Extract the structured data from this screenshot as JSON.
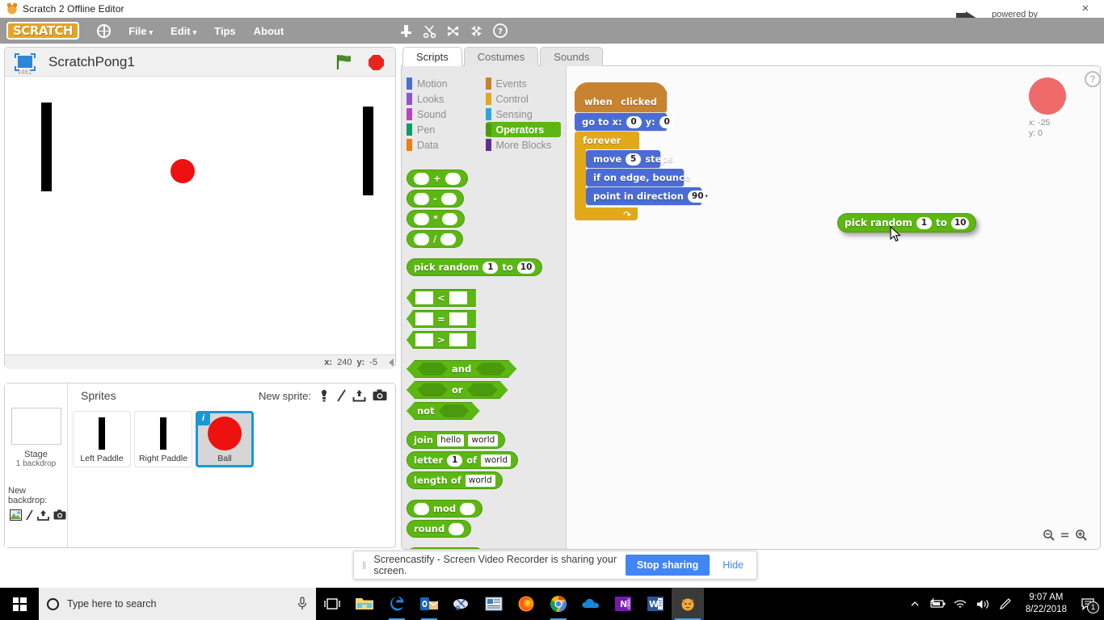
{
  "window": {
    "title": "Scratch 2 Offline Editor",
    "favicon": "scratch-cat-icon",
    "close_label": "×"
  },
  "branding": {
    "powered_by": "powered by",
    "name": "Screencastify"
  },
  "menubar": {
    "logo": "SCRATCH",
    "globe": "globe-icon",
    "items": [
      {
        "label": "File",
        "caret": "▾"
      },
      {
        "label": "Edit",
        "caret": "▾"
      },
      {
        "label": "Tips",
        "caret": ""
      },
      {
        "label": "About",
        "caret": ""
      }
    ],
    "tools": [
      "duplicate-icon",
      "cut-icon",
      "grow-icon",
      "shrink-icon",
      "block-help-icon"
    ]
  },
  "stage": {
    "version": "v461",
    "project_name": "ScratchPong1",
    "green_flag": "green-flag-icon",
    "stop": "stop-icon",
    "mouse_x_label": "x:",
    "mouse_x": "240",
    "mouse_y_label": "y:",
    "mouse_y": "-5",
    "sprites_on_stage": [
      {
        "name": "Left Paddle",
        "type": "paddle"
      },
      {
        "name": "Right Paddle",
        "type": "paddle"
      },
      {
        "name": "Ball",
        "type": "ball"
      }
    ]
  },
  "sprite_panel": {
    "stage_label": "Stage",
    "stage_sublabel": "1 backdrop",
    "new_backdrop_label": "New backdrop:",
    "backdrop_icons": [
      "library-icon",
      "paint-icon",
      "upload-icon",
      "camera-icon"
    ],
    "sprites_title": "Sprites",
    "new_sprite_label": "New sprite:",
    "new_sprite_icons": [
      "library-icon",
      "paint-icon",
      "upload-icon",
      "camera-icon"
    ],
    "sprites": [
      {
        "name": "Left Paddle",
        "selected": false,
        "type": "paddle"
      },
      {
        "name": "Right Paddle",
        "selected": false,
        "type": "paddle"
      },
      {
        "name": "Ball",
        "selected": true,
        "type": "ball",
        "badge": "i"
      }
    ]
  },
  "tabs": [
    {
      "label": "Scripts",
      "active": true
    },
    {
      "label": "Costumes",
      "active": false
    },
    {
      "label": "Sounds",
      "active": false
    }
  ],
  "palette": {
    "categories_left": [
      {
        "label": "Motion",
        "color": "#4a6cd4",
        "active": false
      },
      {
        "label": "Looks",
        "color": "#8a55d5",
        "active": false
      },
      {
        "label": "Sound",
        "color": "#bb42c3",
        "active": false
      },
      {
        "label": "Pen",
        "color": "#0e9a6c",
        "active": false
      },
      {
        "label": "Data",
        "color": "#ee7d16",
        "active": false
      }
    ],
    "categories_right": [
      {
        "label": "Events",
        "color": "#c88330",
        "active": false
      },
      {
        "label": "Control",
        "color": "#e1a91a",
        "active": false
      },
      {
        "label": "Sensing",
        "color": "#2ca5e2",
        "active": false
      },
      {
        "label": "Operators",
        "color": "#5cb712",
        "active": true
      },
      {
        "label": "More Blocks",
        "color": "#632d99",
        "active": false
      }
    ],
    "blocks": {
      "add": "+",
      "subtract": "-",
      "multiply": "*",
      "divide": "/",
      "pick_random_pre": "pick random",
      "pick_random_from": "1",
      "pick_random_mid": "to",
      "pick_random_to": "10",
      "less_than": "<",
      "equals": "=",
      "greater_than": ">",
      "and": "and",
      "or": "or",
      "not": "not",
      "join": "join",
      "join_a": "hello",
      "join_b": "world",
      "letter": "letter",
      "letter_n": "1",
      "letter_of": "of",
      "letter_str": "world",
      "length_of": "length of",
      "length_str": "world",
      "mod": "mod",
      "round": "round"
    }
  },
  "script_canvas": {
    "sprite_thumb_color": "#ef6a6a",
    "sprite_x_label": "x:",
    "sprite_x": "-25",
    "sprite_y_label": "y:",
    "sprite_y": "0",
    "help_label": "?",
    "script": {
      "hat_pre": "when",
      "hat_flag": "green-flag-icon",
      "hat_post": "clicked",
      "goto_pre": "go to x:",
      "goto_x": "0",
      "goto_mid": "y:",
      "goto_y": "0",
      "forever": "forever",
      "move_pre": "move",
      "move_steps": "5",
      "move_post": "steps",
      "bounce": "if on edge, bounce",
      "point_pre": "point in direction",
      "point_dir": "90",
      "point_caret": "▾"
    },
    "dragged_block": {
      "pre": "pick random",
      "from": "1",
      "mid": "to",
      "to": "10"
    },
    "zoom_controls": [
      "zoom-out-icon",
      "zoom-reset-icon",
      "zoom-in-icon"
    ]
  },
  "share_bar": {
    "grip": "‖",
    "message": "Screencastify - Screen Video Recorder is sharing your screen.",
    "stop_label": "Stop sharing",
    "hide_label": "Hide"
  },
  "taskbar": {
    "start": "windows-logo-icon",
    "search_placeholder": "Type here to search",
    "mic": "microphone-icon",
    "task_view": "task-view-icon",
    "apps": [
      {
        "name": "file-explorer",
        "running": false
      },
      {
        "name": "microsoft-edge",
        "running": true
      },
      {
        "name": "outlook",
        "running": true
      },
      {
        "name": "snipping-tool",
        "running": false
      },
      {
        "name": "publisher",
        "running": false
      },
      {
        "name": "firefox",
        "running": false
      },
      {
        "name": "google-chrome",
        "running": true
      },
      {
        "name": "onedrive",
        "running": false
      },
      {
        "name": "onenote",
        "running": false
      },
      {
        "name": "word",
        "running": false
      },
      {
        "name": "scratch",
        "running": true,
        "active": true
      }
    ],
    "tray": [
      "show-hidden-icons",
      "battery-icon",
      "wifi-icon",
      "volume-icon",
      "pen-icon"
    ],
    "time": "9:07 AM",
    "date": "8/22/2018",
    "notification_count": "1"
  }
}
